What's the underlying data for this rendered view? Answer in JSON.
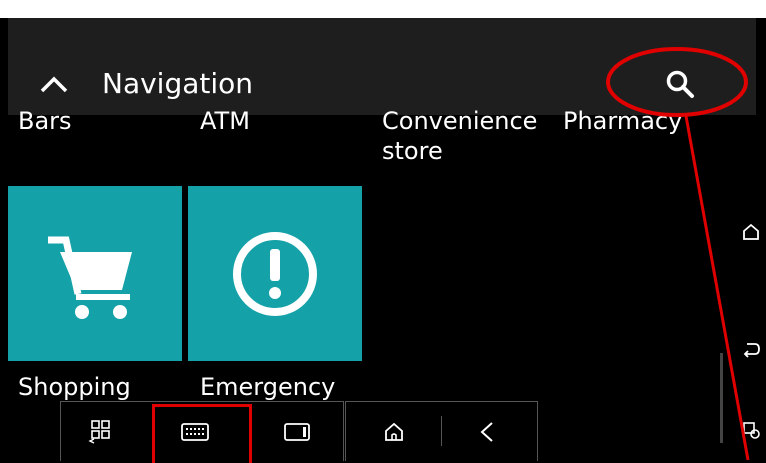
{
  "header": {
    "title": "Navigation",
    "back_icon": "chevron-up-icon",
    "search_icon": "search-icon"
  },
  "categories_top": [
    "Bars",
    "ATM",
    "Convenience store",
    "Pharmacy"
  ],
  "categories_top_lines": {
    "bars": "Bars",
    "atm": "ATM",
    "convenience_line1": "Convenience",
    "convenience_line2": "store",
    "pharmacy": "Pharmacy"
  },
  "tiles": [
    {
      "label": "Shopping",
      "icon": "shopping-cart-icon"
    },
    {
      "label": "Emergency",
      "icon": "exclamation-icon"
    }
  ],
  "colors": {
    "tile": "#14a1a8",
    "header": "#1e1e1e",
    "annotation": "#e00000"
  },
  "system_nav": {
    "left_group": [
      "apps-switch-icon",
      "keyboard-icon",
      "window-icon"
    ],
    "right_group": [
      "home-icon",
      "back-icon"
    ]
  },
  "side_controls": [
    "home-icon",
    "back-icon",
    "settings-icon"
  ]
}
